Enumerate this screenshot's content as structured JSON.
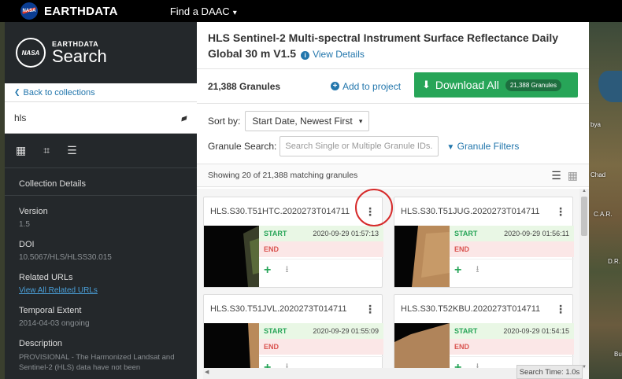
{
  "topbar": {
    "brand": "EARTHDATA",
    "find_daac": "Find a DAAC",
    "logo_text": "NASA"
  },
  "sidebar": {
    "logo_text": "NASA",
    "title_small": "EARTHDATA",
    "title_large": "Search",
    "back_label": "Back to collections",
    "search_query": "hls",
    "details_header": "Collection Details",
    "fields": {
      "version_label": "Version",
      "version_value": "1.5",
      "doi_label": "DOI",
      "doi_value": "10.5067/HLS/HLSS30.015",
      "related_label": "Related URLs",
      "related_link": "View All Related URLs",
      "temporal_label": "Temporal Extent",
      "temporal_value": "2014-04-03 ongoing",
      "description_label": "Description",
      "description_value": "PROVISIONAL - The Harmonized Landsat and Sentinel-2 (HLS) data have not been"
    }
  },
  "panel": {
    "title": "HLS Sentinel-2 Multi-spectral Instrument Surface Reflectance Daily Global 30 m V1.5",
    "view_details": "View Details",
    "granule_count": "21,388 Granules",
    "add_to_project": "Add to project",
    "download_all": "Download All",
    "download_badge": "21,388 Granules",
    "sort_label": "Sort by:",
    "sort_value": "Start Date, Newest First",
    "granule_search_label": "Granule Search:",
    "granule_search_placeholder": "Search Single or Multiple Granule IDs...",
    "granule_filters": "Granule Filters",
    "showing": "Showing 20 of 21,388 matching granules",
    "search_time": "Search Time: 1.0s"
  },
  "granules": [
    {
      "id": "HLS.S30.T51HTC.2020273T014711",
      "start_label": "START",
      "start": "2020-09-29 01:57:13",
      "end_label": "END"
    },
    {
      "id": "HLS.S30.T51JUG.2020273T014711",
      "start_label": "START",
      "start": "2020-09-29 01:56:11",
      "end_label": "END"
    },
    {
      "id": "HLS.S30.T51JVL.2020273T014711",
      "start_label": "START",
      "start": "2020-09-29 01:55:09",
      "end_label": "END"
    },
    {
      "id": "HLS.S30.T52KBU.2020273T014711",
      "start_label": "START",
      "start": "2020-09-29 01:54:15",
      "end_label": "END"
    }
  ],
  "map_labels": {
    "a": "bya",
    "b": "Chad",
    "c": "C.A.R.",
    "d": "D.R.",
    "e": "Bu"
  },
  "colors": {
    "accent_blue": "#2276ac",
    "download_green": "#27a558",
    "highlight_red": "#d62b2b"
  }
}
